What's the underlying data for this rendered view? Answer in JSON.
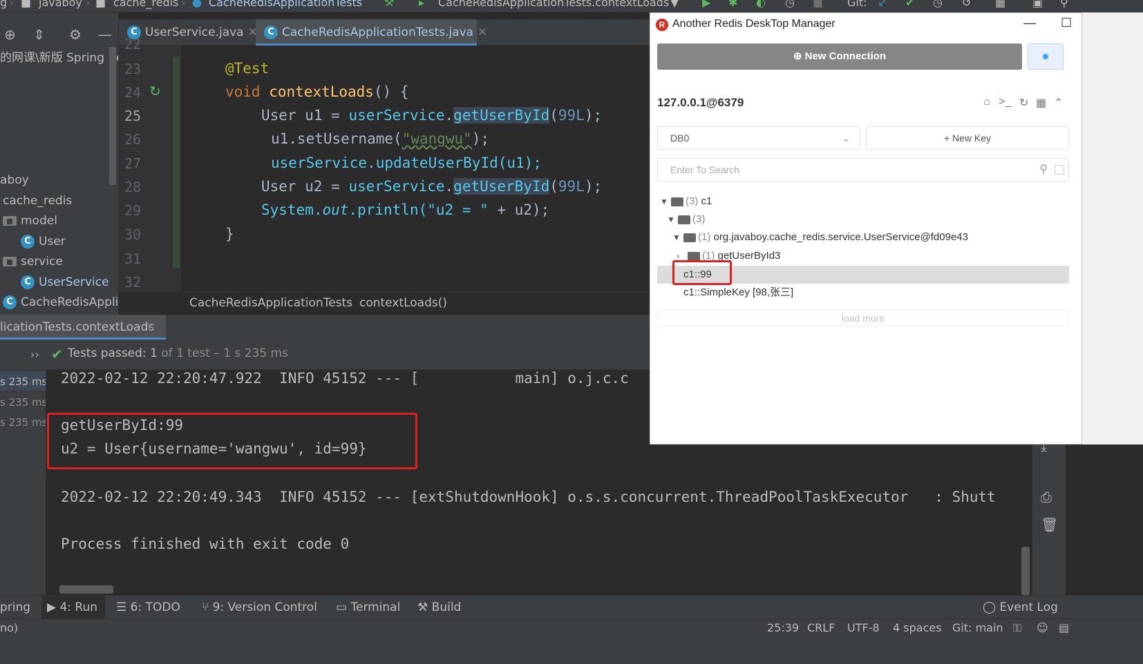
{
  "nav": {
    "crumbs": [
      "g",
      "javaboy",
      "cache_redis",
      "CacheRedisApplicationTests"
    ],
    "run_config": "CacheRedisApplicationTests.contextLoads",
    "git_label": "Git:"
  },
  "project": {
    "path_fragment": "的网课\\新版 Spring Boo",
    "items": [
      {
        "label": "aboy"
      },
      {
        "label": "cache_redis"
      },
      {
        "label": "model"
      },
      {
        "label": "User"
      },
      {
        "label": "service"
      },
      {
        "label": "UserService"
      },
      {
        "label": "CacheRedisApplic"
      }
    ]
  },
  "editor": {
    "tabs": [
      {
        "label": "UserService.java"
      },
      {
        "label": "CacheRedisApplicationTests.java"
      }
    ],
    "line_numbers": [
      "22",
      "23",
      "24",
      "25",
      "26",
      "27",
      "28",
      "29",
      "30",
      "31",
      "32"
    ],
    "code": {
      "l23": "@Test",
      "l24_kw": "void",
      "l24_fn": "contextLoads",
      "l24_rest": "() {",
      "l25_a": "User u1 = ",
      "l25_b": "userService",
      "l25_c": "getUserById",
      "l25_d": "99L",
      "l26_a": "u1.setUsername(",
      "l26_b": "\"wangwu\"",
      "l26_c": ");",
      "l27_a": "userService",
      "l27_b": ".updateUserById(u1);",
      "l28_a": "User u2 = ",
      "l28_b": "userService",
      "l28_c": "getUserById",
      "l28_d": "99L",
      "l29_a": "System.",
      "l29_b": "out",
      "l29_c": ".println(",
      "l29_d": "\"u2 = \"",
      "l29_e": " + u2);",
      "l30": "}"
    },
    "breadcrumb": [
      "CacheRedisApplicationTests",
      "contextLoads()"
    ]
  },
  "run": {
    "tab_label": "licationTests.contextLoads",
    "tests_passed_label": "Tests passed:",
    "tests_passed_value": "1",
    "tests_of": "of 1 test",
    "tests_time": "– 1 s 235 ms",
    "timings": [
      "s 235 ms",
      "s 235 ms",
      "s 235 ms"
    ],
    "console": [
      "2022-02-12 22:20:47.922  INFO 45152 --- [           main] o.j.c.c",
      "getUserById:99",
      "u2 = User{username='wangwu', id=99}",
      "2022-02-12 22:20:49.343  INFO 45152 --- [extShutdownHook] o.s.s.concurrent.ThreadPoolTaskExecutor   : Shutt",
      "Process finished with exit code 0"
    ]
  },
  "toolwindows": {
    "spring": "pring",
    "run": "4: Run",
    "todo": "6: TODO",
    "vcs": "9: Version Control",
    "terminal": "Terminal",
    "build": "Build",
    "event_log": "Event Log"
  },
  "status": {
    "left": "no)",
    "position": "25:39",
    "line_sep": "CRLF",
    "encoding": "UTF-8",
    "indent": "4 spaces",
    "git": "Git: main"
  },
  "rdm": {
    "title": "Another Redis DeskTop Manager",
    "new_connection": "New Connection",
    "connection": "127.0.0.1@6379",
    "db": "DB0",
    "new_key": "+ New Key",
    "search_placeholder": "Enter To Search",
    "tree": {
      "root_count": "(3)",
      "root_name": "c1",
      "lvl1_count": "(3)",
      "lvl2_count": "(1)",
      "lvl2_name": "org.javaboy.cache_redis.service.UserService@fd09e43",
      "lvl3_count": "(1)",
      "lvl3_name": "getUserById3",
      "key1": "c1::99",
      "key2": "c1::SimpleKey [98,张三]"
    },
    "load_more": "load more"
  },
  "colors": {
    "accent": "#4a88c7",
    "highlight_box": "#e02020",
    "pass_green": "#5fb85f"
  }
}
